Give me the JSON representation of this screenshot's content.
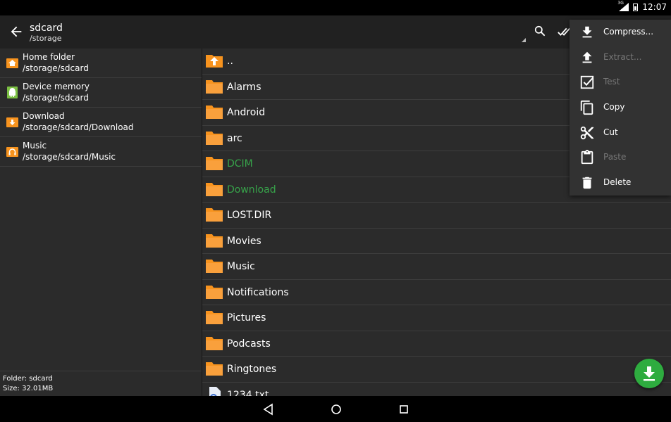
{
  "status_bar": {
    "network": "3G",
    "time": "12:07"
  },
  "toolbar": {
    "title": "sdcard",
    "path": "/storage"
  },
  "places": [
    {
      "name": "Home folder",
      "path": "/storage/sdcard",
      "icon": "home-icon"
    },
    {
      "name": "Device memory",
      "path": "/storage/sdcard",
      "icon": "android-icon"
    },
    {
      "name": "Download",
      "path": "/storage/sdcard/Download",
      "icon": "download-folder-icon"
    },
    {
      "name": "Music",
      "path": "/storage/sdcard/Music",
      "icon": "music-folder-icon"
    }
  ],
  "footer": {
    "folder": "Folder: sdcard",
    "size": "Size: 32.01MB"
  },
  "files": [
    {
      "name": "..",
      "type": "up"
    },
    {
      "name": "Alarms",
      "type": "folder"
    },
    {
      "name": "Android",
      "type": "folder"
    },
    {
      "name": "arc",
      "type": "folder"
    },
    {
      "name": "DCIM",
      "type": "folder",
      "highlight": true
    },
    {
      "name": "Download",
      "type": "folder",
      "highlight": true
    },
    {
      "name": "LOST.DIR",
      "type": "folder"
    },
    {
      "name": "Movies",
      "type": "folder"
    },
    {
      "name": "Music",
      "type": "folder"
    },
    {
      "name": "Notifications",
      "type": "folder"
    },
    {
      "name": "Pictures",
      "type": "folder"
    },
    {
      "name": "Podcasts",
      "type": "folder"
    },
    {
      "name": "Ringtones",
      "type": "folder"
    },
    {
      "name": "1234.txt",
      "type": "file"
    }
  ],
  "menu": [
    {
      "label": "Compress...",
      "icon": "compress-icon",
      "enabled": true
    },
    {
      "label": "Extract...",
      "icon": "extract-icon",
      "enabled": false
    },
    {
      "label": "Test",
      "icon": "test-icon",
      "enabled": false
    },
    {
      "label": "Copy",
      "icon": "copy-icon",
      "enabled": true
    },
    {
      "label": "Cut",
      "icon": "cut-icon",
      "enabled": true
    },
    {
      "label": "Paste",
      "icon": "paste-icon",
      "enabled": false
    },
    {
      "label": "Delete",
      "icon": "delete-icon",
      "enabled": true
    }
  ],
  "colors": {
    "folder": "#f7931e",
    "highlight": "#37a34a",
    "fab": "#2eac3f"
  }
}
